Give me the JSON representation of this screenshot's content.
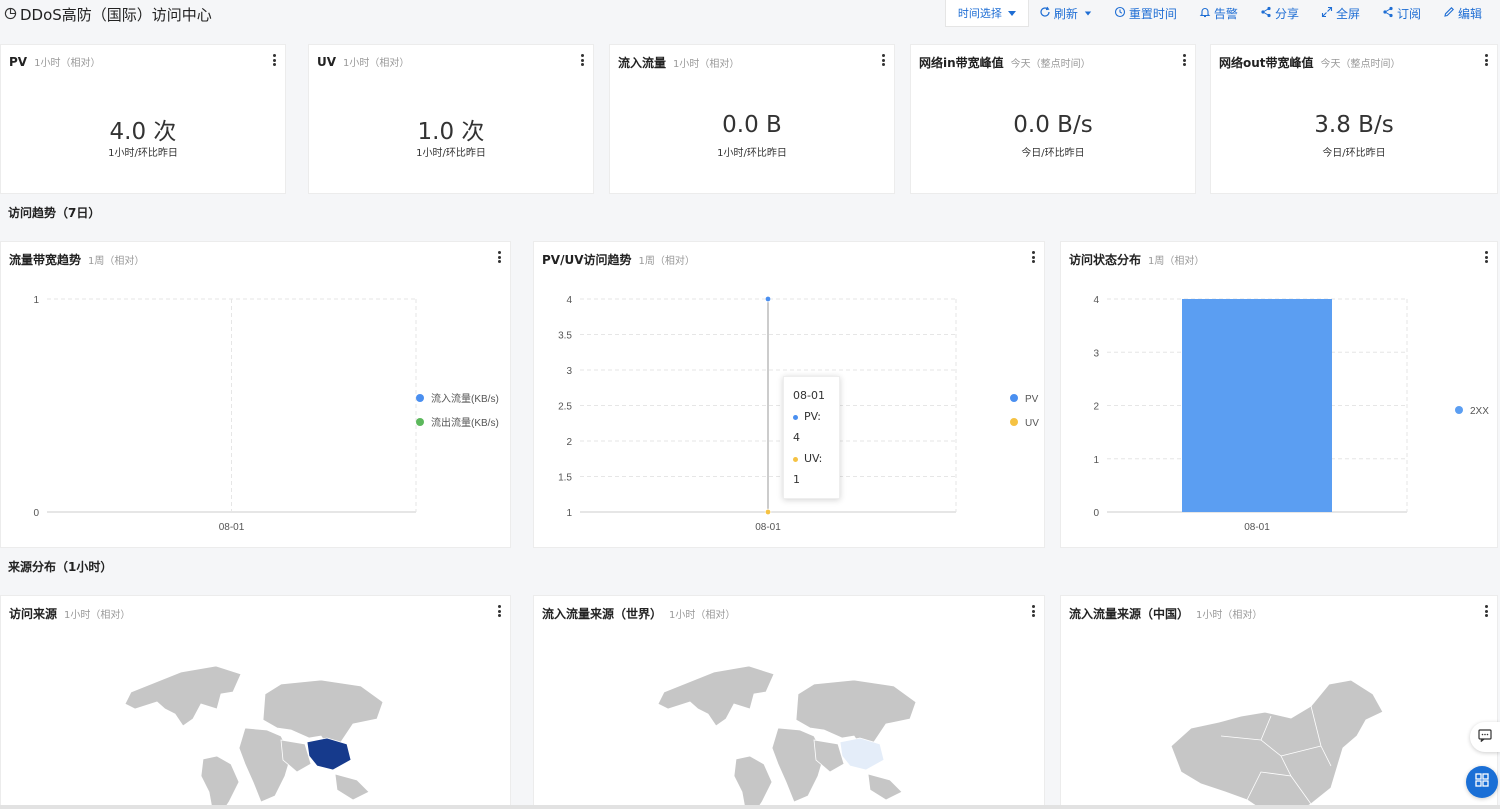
{
  "header": {
    "title": "DDoS高防（国际）访问中心",
    "toolbar": {
      "time_select": "时间选择",
      "refresh": "刷新",
      "reset_time": "重置时间",
      "alert": "告警",
      "share": "分享",
      "fullscreen": "全屏",
      "subscribe": "订阅",
      "edit": "编辑"
    }
  },
  "kpis": [
    {
      "title": "PV",
      "sub": "1小时（相对）",
      "value": "4.0 次",
      "compare": "1小时/环比昨日"
    },
    {
      "title": "UV",
      "sub": "1小时（相对）",
      "value": "1.0 次",
      "compare": "1小时/环比昨日"
    },
    {
      "title": "流入流量",
      "sub": "1小时（相对）",
      "value": "0.0 B",
      "compare": "1小时/环比昨日"
    },
    {
      "title": "网络in带宽峰值",
      "sub": "今天（整点时间）",
      "value": "0.0 B/s",
      "compare": "今日/环比昨日"
    },
    {
      "title": "网络out带宽峰值",
      "sub": "今天（整点时间）",
      "value": "3.8 B/s",
      "compare": "今日/环比昨日"
    }
  ],
  "sections": {
    "trend": "访问趋势（7日）",
    "source": "来源分布（1小时）"
  },
  "charts": {
    "bandwidth": {
      "title": "流量带宽趋势",
      "sub": "1周（相对）"
    },
    "pvuv": {
      "title": "PV/UV访问趋势",
      "sub": "1周（相对）"
    },
    "status": {
      "title": "访问状态分布",
      "sub": "1周（相对）"
    }
  },
  "maps": {
    "visit": {
      "title": "访问来源",
      "sub": "1小时（相对）"
    },
    "world": {
      "title": "流入流量来源（世界）",
      "sub": "1小时（相对）"
    },
    "china": {
      "title": "流入流量来源（中国）",
      "sub": "1小时（相对）"
    }
  },
  "tooltip": {
    "date": "08-01",
    "pv": "PV: 4",
    "uv": "UV: 1"
  },
  "colors": {
    "pv": "#4a8ff0",
    "uv": "#f5c243",
    "inflow": "#4a8ff0",
    "outflow": "#5cb85c",
    "bar": "#5b9ef2",
    "link": "#1f6ed4",
    "map_highlight": "#163a8c"
  },
  "chart_data": [
    {
      "type": "line",
      "title": "流量带宽趋势",
      "x": [
        "08-01"
      ],
      "ylim": [
        0,
        1
      ],
      "yticks": [
        "0",
        "1"
      ],
      "series": [
        {
          "name": "流入流量(KB/s)",
          "values": [
            0
          ]
        },
        {
          "name": "流出流量(KB/s)",
          "values": [
            0
          ]
        }
      ],
      "legend": "right"
    },
    {
      "type": "line",
      "title": "PV/UV访问趋势",
      "x": [
        "08-01"
      ],
      "ylim": [
        1,
        4
      ],
      "yticks": [
        "1",
        "1.5",
        "2",
        "2.5",
        "3",
        "3.5",
        "4"
      ],
      "series": [
        {
          "name": "PV",
          "values": [
            4
          ]
        },
        {
          "name": "UV",
          "values": [
            1
          ]
        }
      ],
      "legend": "right"
    },
    {
      "type": "bar",
      "title": "访问状态分布",
      "categories": [
        "08-01"
      ],
      "ylim": [
        0,
        4
      ],
      "yticks": [
        "0",
        "1",
        "2",
        "3",
        "4"
      ],
      "series": [
        {
          "name": "2XX",
          "values": [
            4
          ]
        }
      ],
      "legend": "right"
    }
  ]
}
